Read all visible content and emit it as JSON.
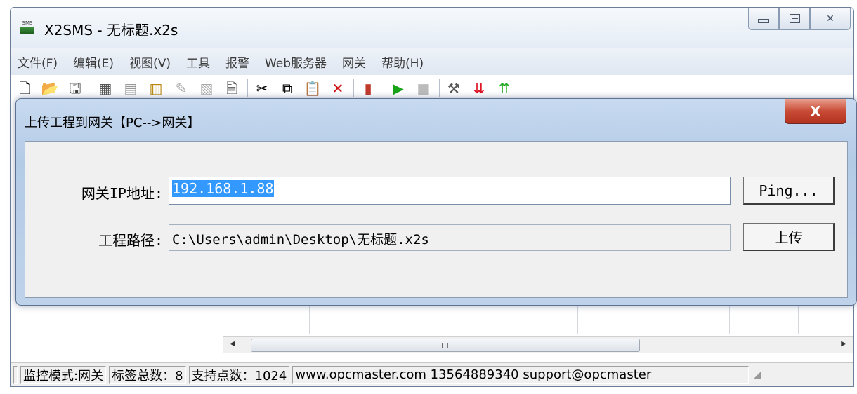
{
  "window": {
    "title": "X2SMS - 无标题.x2s",
    "icon": "sms-app-icon",
    "icon_text": "SMS"
  },
  "menu": [
    "文件(F)",
    "编辑(E)",
    "视图(V)",
    "工具",
    "报警",
    "Web服务器",
    "网关",
    "帮助(H)"
  ],
  "dialog": {
    "title": "上传工程到网关【PC-->网关】",
    "close_label": "X",
    "ip_label": "网关IP地址:",
    "ip_value": "192.168.1.88",
    "path_label": "工程路径:",
    "path_value": "C:\\Users\\admin\\Desktop\\无标题.x2s",
    "ping_button": "Ping...",
    "upload_button": "上传"
  },
  "scrollbar": {
    "grip": "III"
  },
  "status": {
    "mode": "监控模式:网关",
    "tag_count": "标签总数：8",
    "point_count": "支持点数：1024",
    "contact": "www.opcmaster.com 13564889340 support@opcmaster"
  }
}
